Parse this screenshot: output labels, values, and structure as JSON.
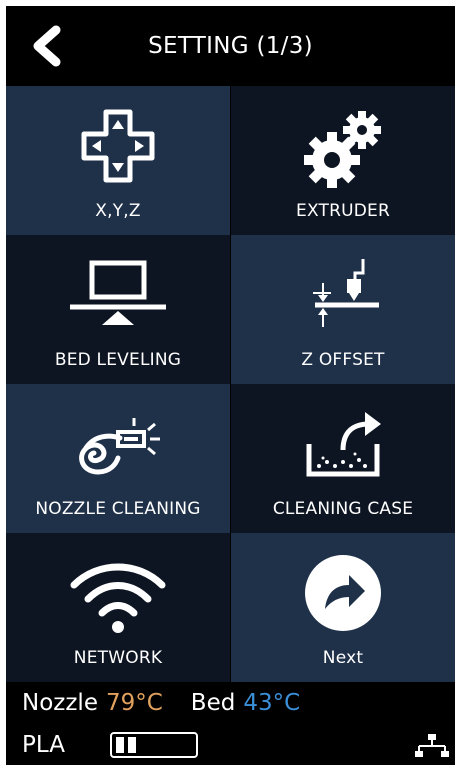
{
  "header": {
    "title": "SETTING (1/3)"
  },
  "tiles": [
    {
      "label": "X,Y,Z",
      "icon": "dpad-icon"
    },
    {
      "label": "EXTRUDER",
      "icon": "gears-icon"
    },
    {
      "label": "BED LEVELING",
      "icon": "bed-leveling-icon"
    },
    {
      "label": "Z OFFSET",
      "icon": "z-offset-icon"
    },
    {
      "label": "NOZZLE CLEANING",
      "icon": "nozzle-cleaning-icon"
    },
    {
      "label": "CLEANING CASE",
      "icon": "cleaning-case-icon"
    },
    {
      "label": "NETWORK",
      "icon": "wifi-icon"
    },
    {
      "label": "Next",
      "icon": "next-arrow-icon"
    }
  ],
  "status": {
    "nozzle_label": "Nozzle",
    "nozzle_temp": "79°C",
    "bed_label": "Bed",
    "bed_temp": "43°C",
    "filament": "PLA",
    "nozzle_temp_color": "#e0a15e",
    "bed_temp_color": "#3a8fd8"
  },
  "colors": {
    "tile_light": "#1f3049",
    "tile_dark": "#0e1522",
    "background": "#000000"
  }
}
